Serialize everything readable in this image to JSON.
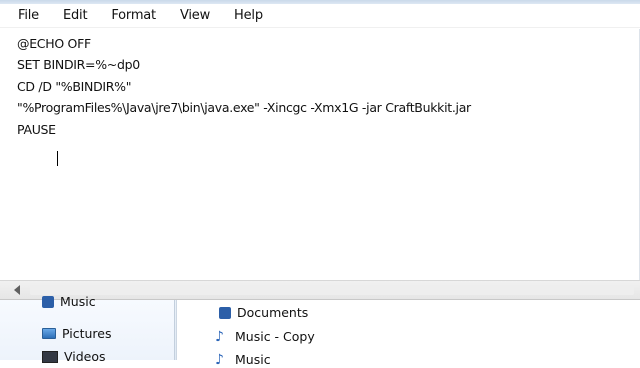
{
  "menu": {
    "items": [
      "File",
      "Edit",
      "Format",
      "View",
      "Help"
    ]
  },
  "editor": {
    "lines": [
      "@ECHO OFF",
      "SET BINDIR=%~dp0",
      "CD /D \"%BINDIR%\"",
      "\"%ProgramFiles%\\Java\\jre7\\bin\\java.exe\" -Xincgc -Xmx1G -jar CraftBukkit.jar",
      "PAUSE"
    ]
  },
  "explorer": {
    "nav_items": [
      {
        "label": "Music",
        "icon": "music-icon"
      },
      {
        "label": "Pictures",
        "icon": "pictures-icon"
      },
      {
        "label": "Videos",
        "icon": "videos-icon"
      }
    ],
    "files": [
      {
        "label": "Documents",
        "icon": "documents-icon"
      },
      {
        "label": "Music - Copy",
        "icon": "music-note-icon"
      },
      {
        "label": "Music",
        "icon": "music-note-icon"
      }
    ]
  }
}
